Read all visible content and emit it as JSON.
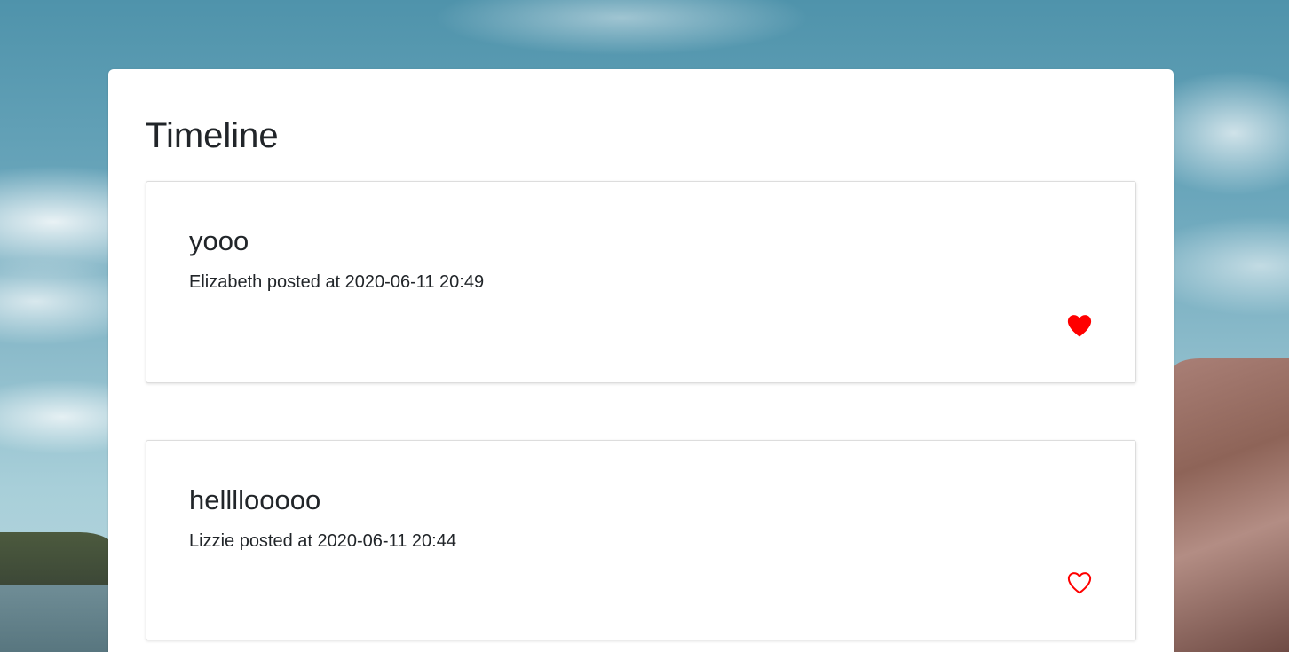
{
  "timeline": {
    "title": "Timeline",
    "posts": [
      {
        "title": "yooo",
        "meta": "Elizabeth posted at 2020-06-11 20:49",
        "liked": true
      },
      {
        "title": "hellllooooo",
        "meta": "Lizzie posted at 2020-06-11 20:44",
        "liked": false
      }
    ]
  },
  "icons": {
    "liked": "heart-filled-icon",
    "unliked": "heart-outline-icon"
  },
  "colors": {
    "heart": "#ff0000",
    "card_bg": "#ffffff",
    "text": "#212529"
  }
}
